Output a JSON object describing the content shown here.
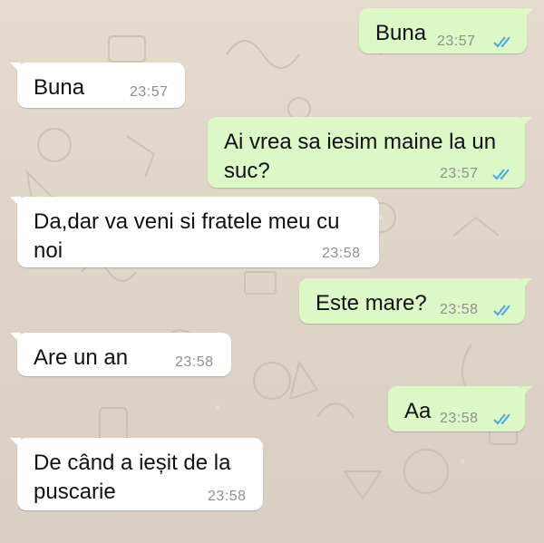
{
  "messages": [
    {
      "direction": "outgoing",
      "lines": [
        "Buna"
      ],
      "time": "23:57",
      "read": true
    },
    {
      "direction": "incoming",
      "lines": [
        "Buna"
      ],
      "time": "23:57"
    },
    {
      "direction": "outgoing",
      "lines": [
        "Ai vrea sa iesim maine la un",
        "suc?"
      ],
      "time": "23:57",
      "read": true
    },
    {
      "direction": "incoming",
      "lines": [
        "Da,dar va veni si fratele meu cu",
        "noi"
      ],
      "time": "23:58"
    },
    {
      "direction": "outgoing",
      "lines": [
        "Este mare?"
      ],
      "time": "23:58",
      "read": true
    },
    {
      "direction": "incoming",
      "lines": [
        "Are un an"
      ],
      "time": "23:58"
    },
    {
      "direction": "outgoing",
      "lines": [
        "Aa"
      ],
      "time": "23:58",
      "read": true
    },
    {
      "direction": "incoming",
      "lines": [
        "De când a ieșit de la",
        "puscarie"
      ],
      "time": "23:58"
    }
  ],
  "colors": {
    "outgoing_bubble": "#dcf8c6",
    "incoming_bubble": "#ffffff",
    "read_ticks": "#4fa3e0",
    "timestamp": "#8f8f8f",
    "wallpaper": "#e6ddd0"
  },
  "icons": {
    "read_receipt": "double-check-icon"
  }
}
